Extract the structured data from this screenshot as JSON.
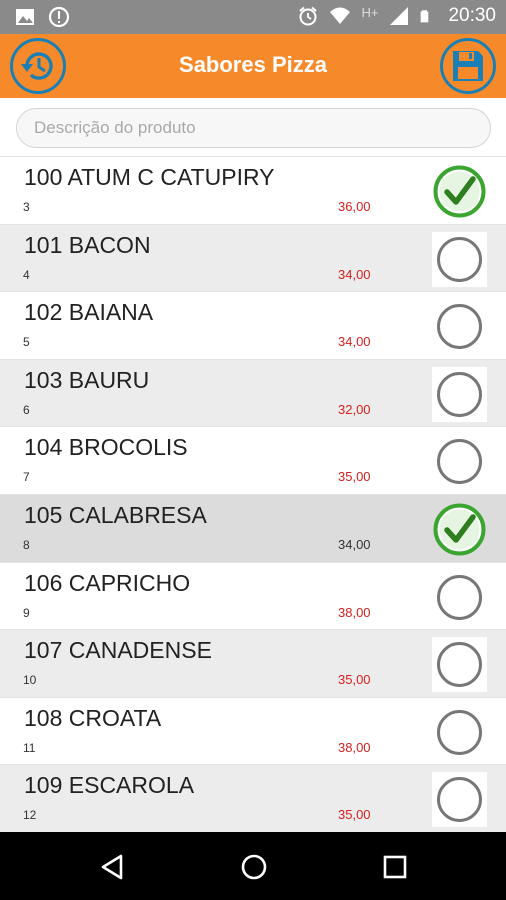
{
  "status_bar": {
    "time": "20:30",
    "network": "H+",
    "icons": [
      "image-icon",
      "alert-icon",
      "alarm-icon",
      "wifi-icon",
      "signal-icon",
      "battery-icon"
    ]
  },
  "app_bar": {
    "title": "Sabores Pizza",
    "left_icon": "history-icon",
    "right_icon": "save-icon",
    "accent": "#f68a2b",
    "icon_color": "#1a7fb5"
  },
  "search": {
    "placeholder": "Descrição do produto",
    "value": ""
  },
  "items": [
    {
      "name": "100 ATUM C CATUPIRY",
      "code": "3",
      "price": "36,00",
      "checked": true
    },
    {
      "name": "101 BACON",
      "code": "4",
      "price": "34,00",
      "checked": false
    },
    {
      "name": "102 BAIANA",
      "code": "5",
      "price": "34,00",
      "checked": false
    },
    {
      "name": "103 BAURU",
      "code": "6",
      "price": "32,00",
      "checked": false
    },
    {
      "name": "104 BROCOLIS",
      "code": "7",
      "price": "35,00",
      "checked": false
    },
    {
      "name": "105 CALABRESA",
      "code": "8",
      "price": "34,00",
      "checked": true
    },
    {
      "name": "106 CAPRICHO",
      "code": "9",
      "price": "38,00",
      "checked": false
    },
    {
      "name": "107 CANADENSE",
      "code": "10",
      "price": "35,00",
      "checked": false
    },
    {
      "name": "108 CROATA",
      "code": "11",
      "price": "38,00",
      "checked": false
    },
    {
      "name": "109 ESCAROLA",
      "code": "12",
      "price": "35,00",
      "checked": false
    }
  ],
  "colors": {
    "price": "#d32020",
    "check_green": "#3aa52f"
  },
  "nav_bar": {
    "buttons": [
      "back-icon",
      "home-icon",
      "recents-icon"
    ]
  }
}
